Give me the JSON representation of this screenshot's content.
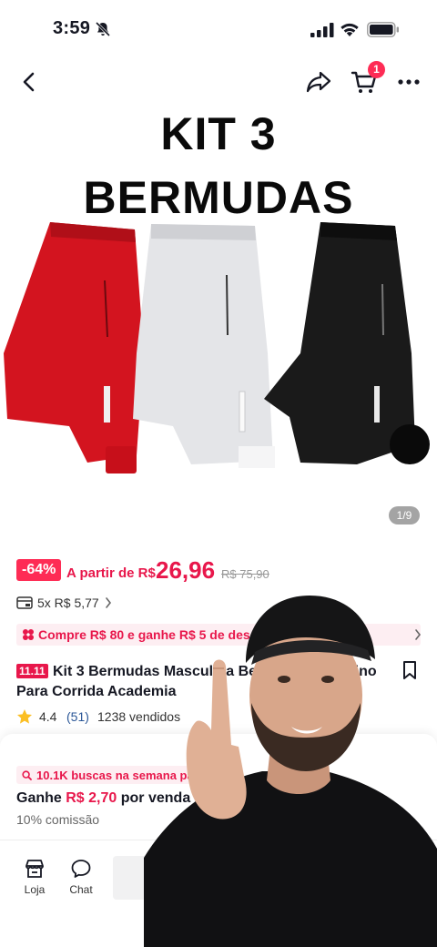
{
  "status_bar": {
    "time": "3:59",
    "icons": [
      "bell-off-icon",
      "cellular-signal-icon",
      "wifi-icon",
      "battery-icon"
    ]
  },
  "nav": {
    "icons": [
      "back-arrow-icon",
      "share-icon",
      "cart-icon",
      "more-icon"
    ],
    "cart_badge": "1"
  },
  "hero": {
    "title_line1": "KIT 3",
    "title_line2": "BERMUDAS",
    "image_counter": "1/9",
    "shorts_colors": [
      "#d3141f",
      "#e4e5e8",
      "#1a1a1a"
    ]
  },
  "price": {
    "discount": "-64%",
    "prefix": "A partir de R$",
    "value": "26,96",
    "old_price": "R$ 75,90"
  },
  "installment": {
    "text": "5x R$ 5,77"
  },
  "promo": {
    "text": "Compre R$ 80 e ganhe R$ 5 de desconto"
  },
  "product": {
    "sale_badge": "11.11",
    "title": "Kit 3 Bermudas Masculina Bermuda Masculino Para Corrida Academia"
  },
  "rating": {
    "value": "4.4",
    "count": "(51)",
    "sold": "1238 vendidos"
  },
  "sheet": {
    "search_text": "10.1K buscas na semana passada",
    "commission_prefix": "Ganhe",
    "commission_value": "R$ 2,70",
    "commission_suffix": "por venda",
    "commission_sub": "10% comissão"
  },
  "bottom_bar": {
    "store_label": "Loja",
    "chat_label": "Chat"
  },
  "colors": {
    "accent": "#fe2c55",
    "price": "#e8174b",
    "promo_bg": "#fdeef2"
  }
}
